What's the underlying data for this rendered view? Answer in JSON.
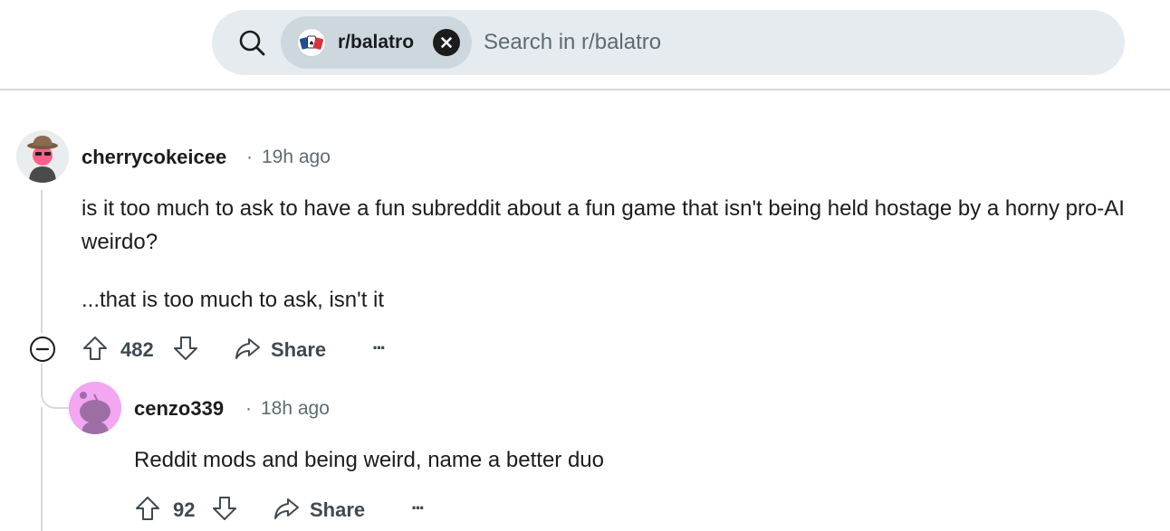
{
  "search": {
    "community_chip": "r/balatro",
    "placeholder": "Search in r/balatro",
    "icons": {
      "search": "search-icon",
      "clear": "close-icon"
    }
  },
  "comments": [
    {
      "author": "cherrycokeicee",
      "time": "19h ago",
      "paragraphs": [
        "is it too much to ask to have a fun subreddit about a fun game that isn't being held hostage by a horny pro-AI weirdo?",
        "...that is too much to ask, isn't it"
      ],
      "score": "482",
      "share_label": "Share",
      "more_label": "···",
      "avatar_colors": {
        "bg": "#e9edef",
        "skin": "#ff5f8a",
        "hat": "#7a5a44"
      }
    },
    {
      "author": "cenzo339",
      "time": "18h ago",
      "paragraphs": [
        "Reddit mods and being weird, name a better duo"
      ],
      "score": "92",
      "share_label": "Share",
      "more_label": "···",
      "avatar_colors": {
        "bg": "#f3a6f1",
        "body": "#9b6fa6"
      }
    }
  ],
  "meta_separator": "·",
  "colors": {
    "text": "#1c1c1c",
    "muted": "#5c6c74",
    "search_bg": "#e5ebee",
    "chip_bg": "#cdd8de"
  }
}
